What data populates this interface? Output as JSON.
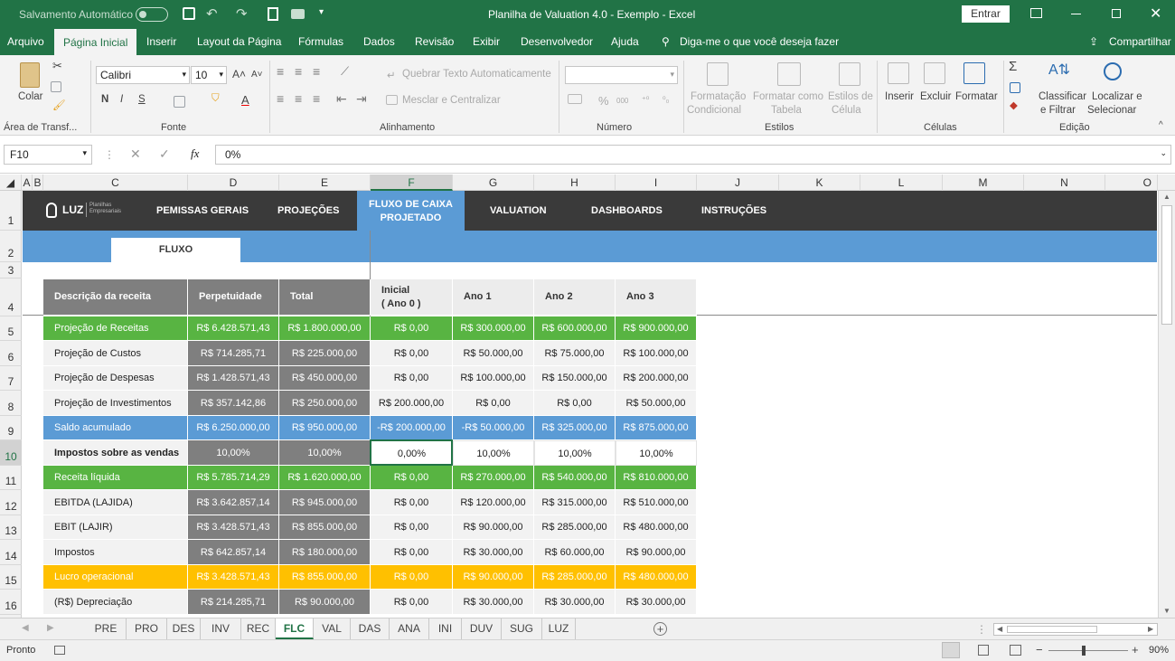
{
  "titlebar": {
    "autosave": "Salvamento Automático",
    "autosave_state": "off",
    "title": "Planilha de Valuation 4.0 - Exemplo  -  Excel",
    "signin": "Entrar"
  },
  "ribbon_tabs": [
    "Arquivo",
    "Página Inicial",
    "Inserir",
    "Layout da Página",
    "Fórmulas",
    "Dados",
    "Revisão",
    "Exibir",
    "Desenvolvedor",
    "Ajuda"
  ],
  "tell_me": "Diga-me o que você deseja fazer",
  "share": "Compartilhar",
  "ribbon": {
    "paste": "Colar",
    "clipboard_group": "Área de Transf...",
    "font_name": "Calibri",
    "font_size": "10",
    "font_group": "Fonte",
    "wrap_text": "Quebrar Texto Automaticamente",
    "merge_center": "Mesclar e Centralizar",
    "align_group": "Alinhamento",
    "number_format": "",
    "number_group": "Número",
    "cond_format": [
      "Formatação",
      "Condicional"
    ],
    "format_table": [
      "Formatar como",
      "Tabela"
    ],
    "cell_styles": [
      "Estilos de",
      "Célula"
    ],
    "styles_group": "Estilos",
    "insert": "Inserir",
    "delete": "Excluir",
    "format": "Formatar",
    "cells_group": "Células",
    "sort_filter": [
      "Classificar",
      "e Filtrar"
    ],
    "find_select": [
      "Localizar e",
      "Selecionar"
    ],
    "edit_group": "Edição"
  },
  "formula_bar": {
    "name_box": "F10",
    "formula": "0%"
  },
  "columns": [
    "A",
    "B",
    "C",
    "D",
    "E",
    "F",
    "G",
    "H",
    "I",
    "J",
    "K",
    "L",
    "M",
    "N",
    "O"
  ],
  "rows": [
    "1",
    "2",
    "3",
    "4",
    "5",
    "6",
    "7",
    "8",
    "9",
    "10",
    "11",
    "12",
    "13",
    "14",
    "15",
    "16"
  ],
  "sheet_nav": {
    "logo": "LUZ",
    "logo_sub": [
      "Planilhas",
      "Empresariais"
    ],
    "items": [
      "PEMISSAS GERAIS",
      "PROJEÇÕES",
      "FLUXO DE CAIXA PROJETADO",
      "VALUATION",
      "DASHBOARDS",
      "INSTRUÇÕES"
    ],
    "subtab": "FLUXO"
  },
  "table": {
    "headers": [
      "Descrição da receita",
      "Perpetuidade",
      "Total",
      "Inicial",
      "( Ano 0 )",
      "Ano 1",
      "Ano 2",
      "Ano 3"
    ],
    "rows": [
      {
        "style": "green",
        "label": "Projeção de Receitas",
        "values": [
          "R$ 6.428.571,43",
          "R$ 1.800.000,00",
          "R$ 0,00",
          "R$ 300.000,00",
          "R$ 600.000,00",
          "R$ 900.000,00"
        ]
      },
      {
        "style": "plain",
        "label": "Projeção de Custos",
        "values": [
          "R$ 714.285,71",
          "R$ 225.000,00",
          "R$ 0,00",
          "R$ 50.000,00",
          "R$ 75.000,00",
          "R$ 100.000,00"
        ]
      },
      {
        "style": "plain",
        "label": "Projeção de Despesas",
        "values": [
          "R$ 1.428.571,43",
          "R$ 450.000,00",
          "R$ 0,00",
          "R$ 100.000,00",
          "R$ 150.000,00",
          "R$ 200.000,00"
        ]
      },
      {
        "style": "plain",
        "label": "Projeção de Investimentos",
        "values": [
          "R$ 357.142,86",
          "R$ 250.000,00",
          "R$ 200.000,00",
          "R$ 0,00",
          "R$ 0,00",
          "R$ 50.000,00"
        ]
      },
      {
        "style": "blue",
        "label": "Saldo acumulado",
        "values": [
          "R$ 6.250.000,00",
          "R$ 950.000,00",
          "-R$ 200.000,00",
          "-R$ 50.000,00",
          "R$ 325.000,00",
          "R$ 875.000,00"
        ]
      },
      {
        "style": "bold",
        "label": "Impostos sobre as vendas",
        "values": [
          "10,00%",
          "10,00%",
          "0,00%",
          "10,00%",
          "10,00%",
          "10,00%"
        ]
      },
      {
        "style": "green",
        "label": "Receita líquida",
        "values": [
          "R$ 5.785.714,29",
          "R$ 1.620.000,00",
          "R$ 0,00",
          "R$ 270.000,00",
          "R$ 540.000,00",
          "R$ 810.000,00"
        ]
      },
      {
        "style": "plain",
        "label": "EBITDA (LAJIDA)",
        "values": [
          "R$ 3.642.857,14",
          "R$ 945.000,00",
          "R$ 0,00",
          "R$ 120.000,00",
          "R$ 315.000,00",
          "R$ 510.000,00"
        ]
      },
      {
        "style": "plain",
        "label": "EBIT (LAJIR)",
        "values": [
          "R$ 3.428.571,43",
          "R$ 855.000,00",
          "R$ 0,00",
          "R$ 90.000,00",
          "R$ 285.000,00",
          "R$ 480.000,00"
        ]
      },
      {
        "style": "plain",
        "label": "Impostos",
        "values": [
          "R$ 642.857,14",
          "R$ 180.000,00",
          "R$ 0,00",
          "R$ 30.000,00",
          "R$ 60.000,00",
          "R$ 90.000,00"
        ]
      },
      {
        "style": "orange",
        "label": "Lucro operacional",
        "values": [
          "R$ 3.428.571,43",
          "R$ 855.000,00",
          "R$ 0,00",
          "R$ 90.000,00",
          "R$ 285.000,00",
          "R$ 480.000,00"
        ]
      },
      {
        "style": "plain",
        "label": "(R$) Depreciação",
        "values": [
          "R$ 214.285,71",
          "R$ 90.000,00",
          "R$ 0,00",
          "R$ 30.000,00",
          "R$ 30.000,00",
          "R$ 30.000,00"
        ]
      }
    ]
  },
  "sheets": [
    "PRE",
    "PRO",
    "DES",
    "INV",
    "REC",
    "FLC",
    "VAL",
    "DAS",
    "ANA",
    "INI",
    "DUV",
    "SUG",
    "LUZ"
  ],
  "active_sheet": "FLC",
  "status": {
    "ready": "Pronto",
    "zoom": "90%"
  },
  "colors": {
    "excel_green": "#217346",
    "green": "#58b442",
    "blue": "#5b9bd5",
    "orange": "#ffc000",
    "dark": "#3a3a3a",
    "gray": "#7f7f7f"
  }
}
